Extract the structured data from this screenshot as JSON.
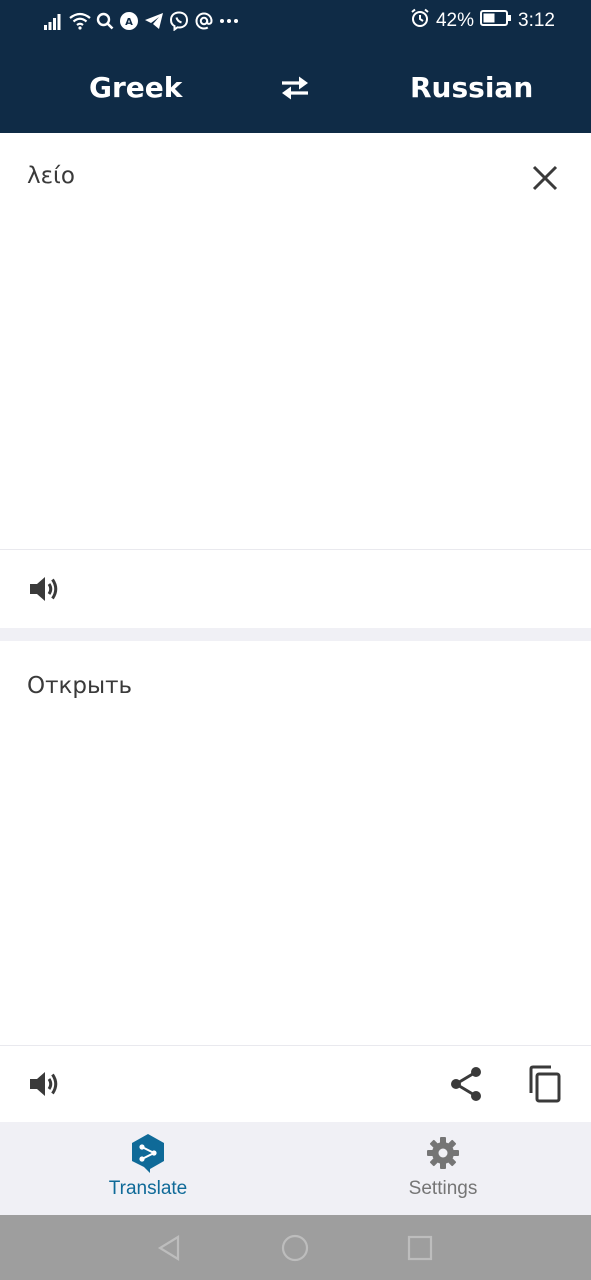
{
  "status_bar": {
    "battery_percent": "42%",
    "time": "3:12",
    "icons": [
      "signal-icon",
      "wifi-icon",
      "search-icon",
      "app-notification-icon",
      "telegram-icon",
      "viber-icon",
      "at-icon",
      "more-icon",
      "alarm-icon",
      "battery-icon"
    ]
  },
  "language_bar": {
    "source_language": "Greek",
    "target_language": "Russian",
    "swap_icon": "swap-arrows-icon"
  },
  "source": {
    "text": "λείο",
    "clear_icon": "close-icon",
    "speak_icon": "speaker-icon"
  },
  "target": {
    "text": "Открыть",
    "speak_icon": "speaker-icon",
    "share_icon": "share-icon",
    "copy_icon": "copy-icon"
  },
  "bottom_nav": {
    "items": [
      {
        "label": "Translate",
        "icon": "deepl-logo-icon",
        "active": true
      },
      {
        "label": "Settings",
        "icon": "gear-icon",
        "active": false
      }
    ]
  },
  "system_nav": {
    "icons": [
      "back-icon",
      "home-icon",
      "recent-apps-icon"
    ]
  },
  "colors": {
    "header": "#0f2b46",
    "accent": "#0f6a98",
    "text": "#3a3a3a",
    "nav_background": "#f0f0f5",
    "system_nav": "#9e9e9e"
  }
}
